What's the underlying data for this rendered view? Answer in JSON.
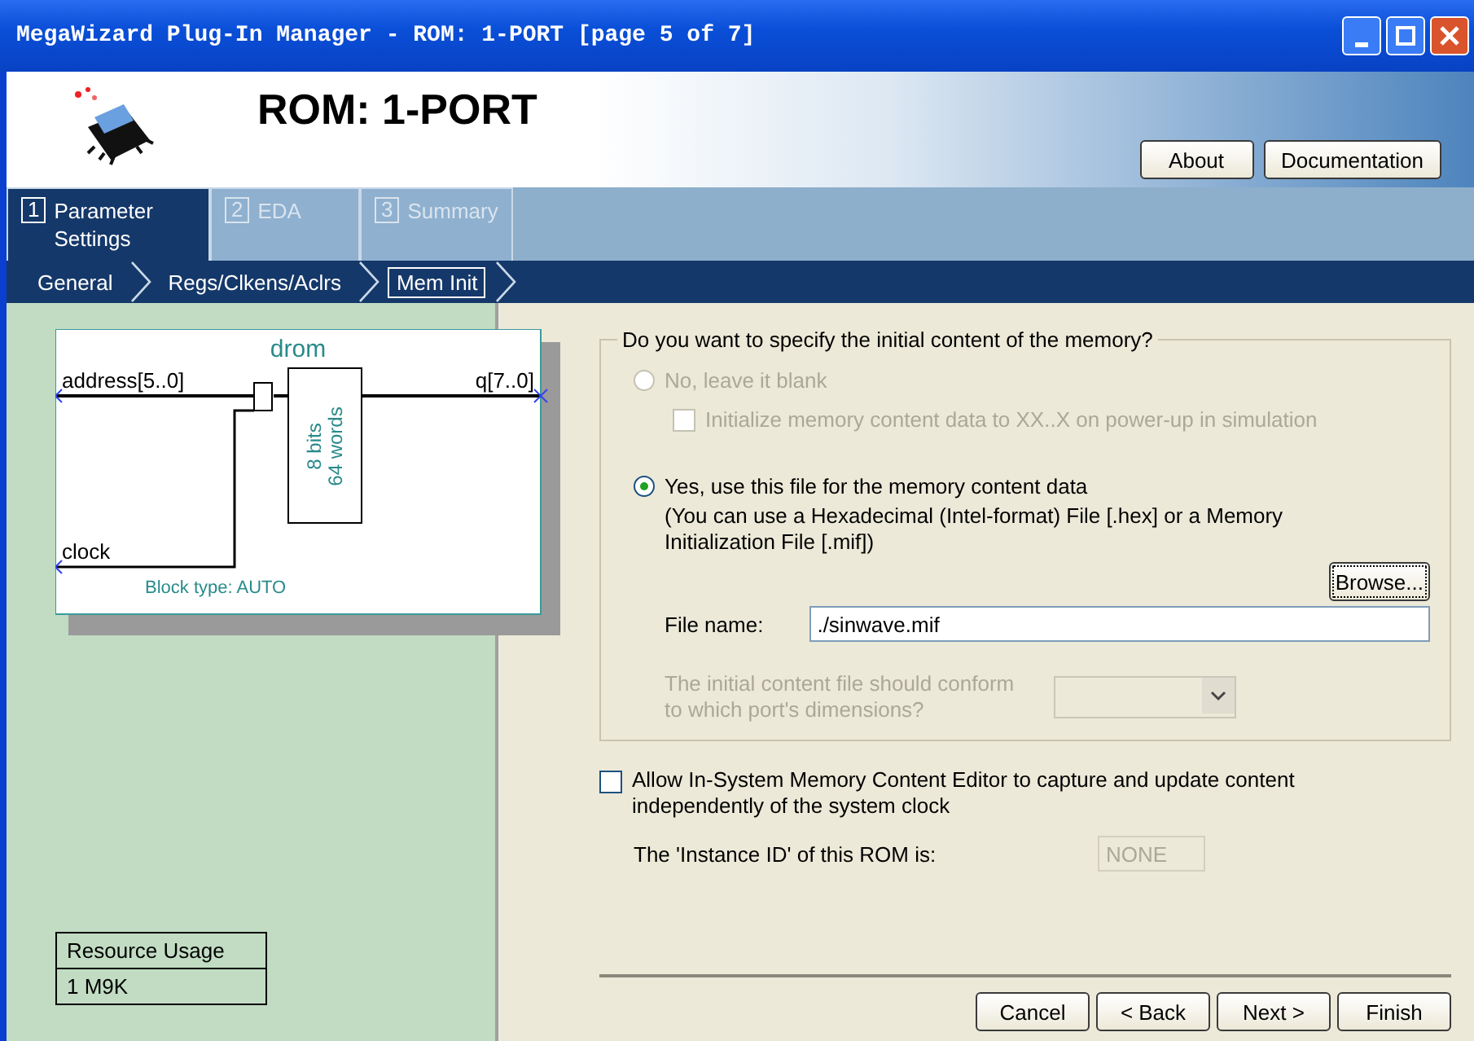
{
  "window": {
    "title": "MegaWizard Plug-In Manager - ROM: 1-PORT [page 5 of 7]"
  },
  "header": {
    "title": "ROM: 1-PORT",
    "buttons": [
      "About",
      "Documentation"
    ]
  },
  "tabs": [
    {
      "number": "1",
      "label": "Parameter Settings",
      "selected": true
    },
    {
      "number": "2",
      "label": "EDA",
      "selected": false
    },
    {
      "number": "3",
      "label": "Summary",
      "selected": false
    }
  ],
  "breadcrumb": [
    {
      "label": "General",
      "selected": false
    },
    {
      "label": "Regs/Clkens/Aclrs",
      "selected": false
    },
    {
      "label": "Mem Init",
      "selected": true
    }
  ],
  "diagram": {
    "name": "drom",
    "inputs": [
      "address[5..0]",
      "clock"
    ],
    "output": "q[7..0]",
    "block_lines": [
      "8 bits",
      "64 words"
    ],
    "block_type": "Block type: AUTO"
  },
  "resource_usage": {
    "heading": "Resource Usage",
    "value": "1 M9K"
  },
  "memory_group": {
    "legend": "Do you want to specify the initial content of the memory?",
    "options": [
      {
        "label": "No, leave it blank",
        "selected": false,
        "disabled": true
      },
      {
        "label": "Yes, use this file for the memory content data",
        "selected": true,
        "disabled": false
      }
    ],
    "init_checkbox": {
      "label": "Initialize memory content data to XX..X on power-up in simulation",
      "checked": false,
      "disabled": true
    },
    "hint_lines": [
      "(You can use a Hexadecimal (Intel-format) File [.hex] or a Memory",
      "Initialization File [.mif])"
    ],
    "browse": "Browse...",
    "file_label": "File name:",
    "file_value": "./sinwave.mif",
    "port_lines": [
      "The initial content file should conform",
      "to which port's dimensions?"
    ],
    "port_disabled": true
  },
  "editor_checkbox": {
    "lines": [
      "Allow In-System Memory Content Editor to capture and update content",
      "independently of the system clock"
    ],
    "checked": false
  },
  "instance": {
    "label": "The 'Instance ID' of this ROM is:",
    "value": "NONE"
  },
  "buttons": [
    "Cancel",
    "< Back",
    "Next >",
    "Finish"
  ]
}
